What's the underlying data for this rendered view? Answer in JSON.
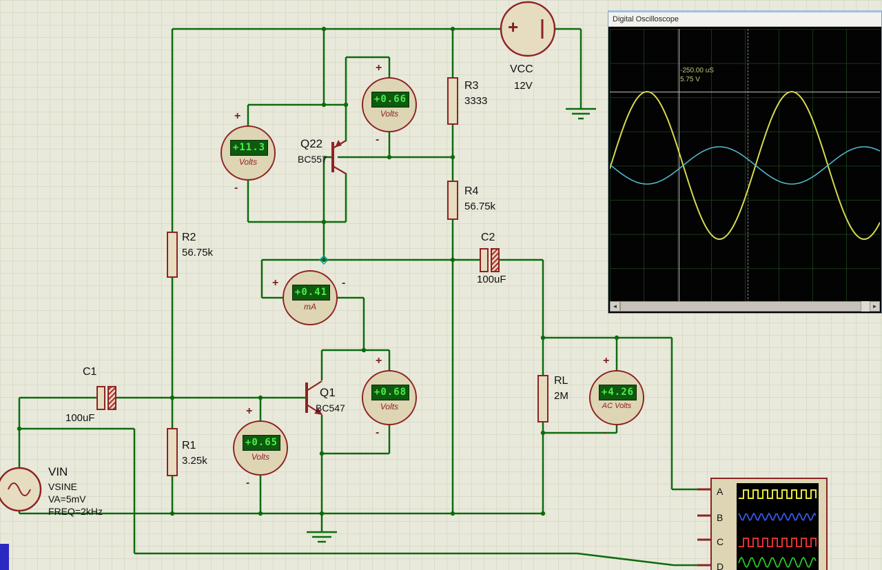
{
  "signs": {
    "plus": "+",
    "minus": "-"
  },
  "components": {
    "vcc": {
      "name": "VCC",
      "value": "12V"
    },
    "r1": {
      "name": "R1",
      "value": "3.25k"
    },
    "r2": {
      "name": "R2",
      "value": "56.75k"
    },
    "r3": {
      "name": "R3",
      "value": "3333"
    },
    "r4": {
      "name": "R4",
      "value": "56.75k"
    },
    "rl": {
      "name": "RL",
      "value": "2M"
    },
    "c1": {
      "name": "C1",
      "value": "100uF"
    },
    "c2": {
      "name": "C2",
      "value": "100uF"
    },
    "q1": {
      "name": "Q1",
      "value": "BC547"
    },
    "q22": {
      "name": "Q22",
      "value": "BC557"
    },
    "vin": {
      "name": "VIN",
      "model": "VSINE",
      "amplitude": "VA=5mV",
      "frequency": "FREQ=2kHz"
    }
  },
  "meters": {
    "m1": {
      "value": "+0.66",
      "unit": "Volts"
    },
    "m2": {
      "value": "+11.3",
      "unit": "Volts"
    },
    "m3": {
      "value": "+0.41",
      "unit": "mA"
    },
    "m4": {
      "value": "+0.68",
      "unit": "Volts"
    },
    "m5": {
      "value": "+0.65",
      "unit": "Volts"
    },
    "m6": {
      "value": "+4.26",
      "unit": "AC Volts"
    }
  },
  "oscilloscope": {
    "title": "Digital Oscilloscope",
    "cursor_time": "-250.00 uS",
    "cursor_volts": "5.75 V",
    "scroll_left": "◄",
    "scroll_right": "►"
  },
  "probe": {
    "channels": [
      "A",
      "B",
      "C",
      "D"
    ]
  }
}
